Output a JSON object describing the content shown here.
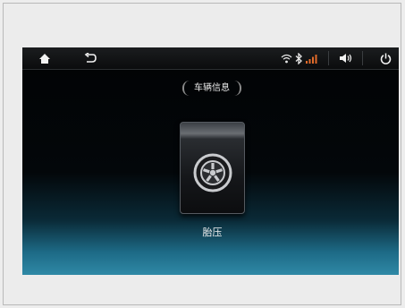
{
  "statusbar": {
    "icons": {
      "home": "home-icon",
      "back": "back-icon",
      "wifi": "wifi-icon",
      "bluetooth": "bluetooth-icon",
      "signal": "signal-icon",
      "volume": "volume-icon",
      "power": "power-icon"
    }
  },
  "header": {
    "title": "车辆信息"
  },
  "main": {
    "tiles": [
      {
        "label": "胎压",
        "icon": "tire-icon"
      }
    ]
  },
  "colors": {
    "screen_bottom_glow": "#2f89a6",
    "signal_accent": "#e06a2a"
  }
}
